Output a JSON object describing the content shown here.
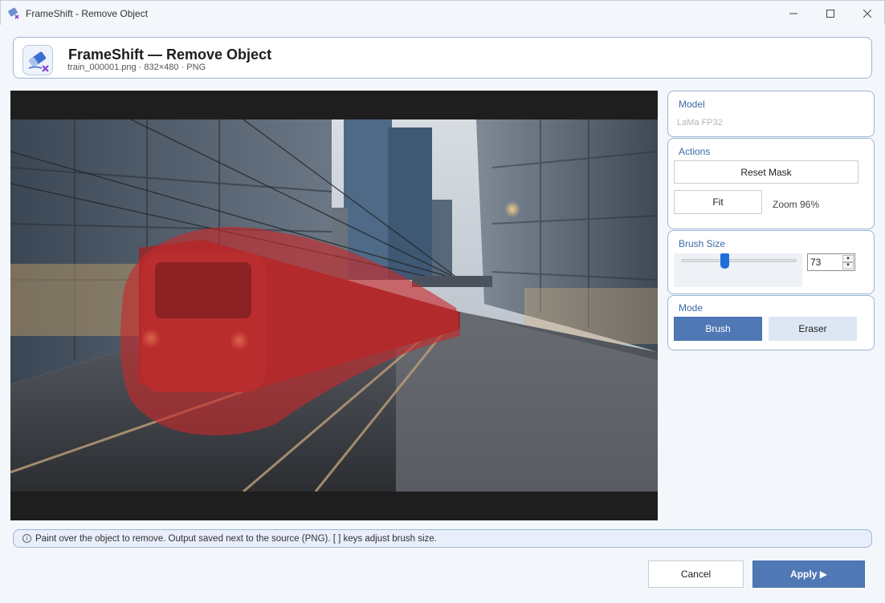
{
  "window": {
    "title": "FrameShift - Remove Object",
    "minimize_icon": "minimize-icon",
    "maximize_icon": "maximize-icon",
    "close_icon": "close-icon"
  },
  "header": {
    "title": "FrameShift — Remove Object",
    "subtitle": "train_000001.png · 832×480 · PNG",
    "logo_icon": "eraser-icon"
  },
  "panels": {
    "model": {
      "title": "Model",
      "value": "LaMa FP32"
    },
    "actions": {
      "title": "Actions",
      "reset_label": "Reset Mask",
      "fit_label": "Fit",
      "zoom_text": "Zoom 96%"
    },
    "brush": {
      "title": "Brush Size",
      "value": "73",
      "level": 0.38
    },
    "mode": {
      "title": "Mode",
      "brush_label": "Brush",
      "eraser_label": "Eraser",
      "selected": "Brush"
    }
  },
  "status": {
    "message": "Paint over the object to remove. Output saved next to the source (PNG). [ ] keys adjust brush size."
  },
  "footer": {
    "cancel_label": "Cancel",
    "apply_label": "Apply ▶"
  },
  "colors": {
    "accent": "#4f78b5",
    "border": "#9cb6d4",
    "mask": "#c8282a",
    "slider_thumb": "#1f6fd6"
  }
}
